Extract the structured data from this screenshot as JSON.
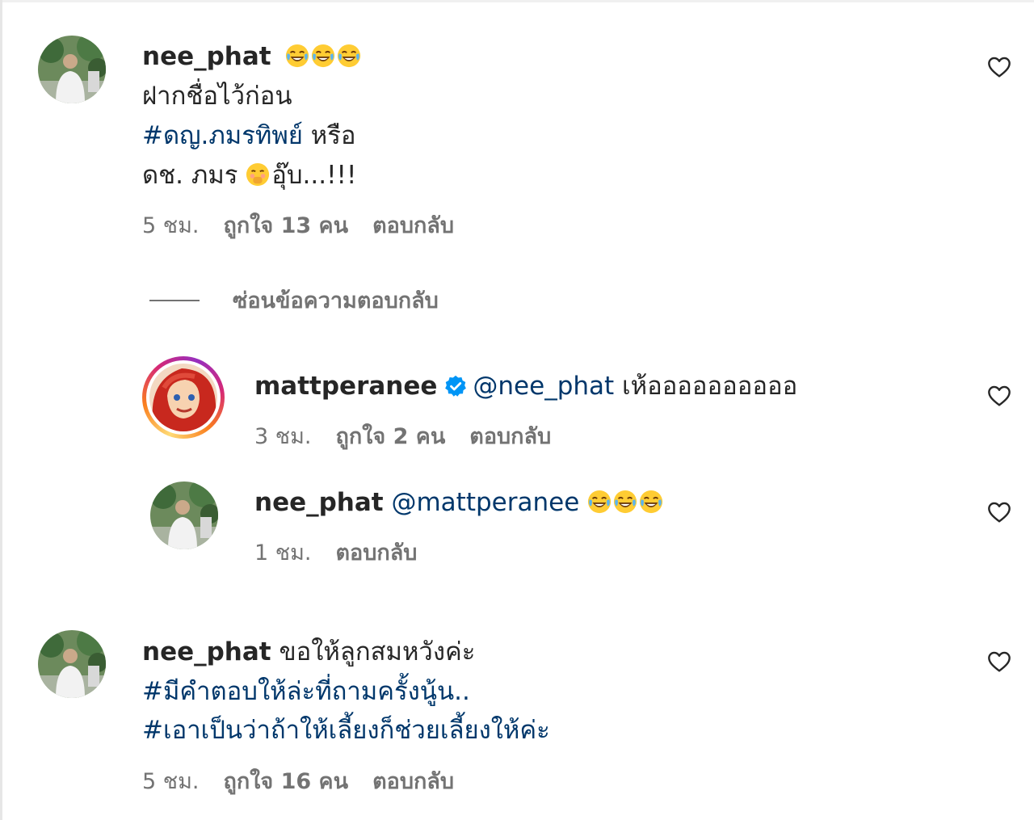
{
  "comments": [
    {
      "username": "nee_phat",
      "title_emoji": [
        "laughing-tears",
        "laughing-tears",
        "laughing-tears"
      ],
      "line1": "ฝากชื่อไว้ก่อน",
      "hashtag": "#ดญ.ภมรทิพย์",
      "line2_suffix": " หรือ",
      "line3_prefix": "ดช. ภมร ",
      "line3_suffix": "อุ๊บ...!!!",
      "time": "5 ชม.",
      "likes": "ถูกใจ 13 คน",
      "reply": "ตอบกลับ"
    },
    {
      "username": "nee_phat",
      "text": " ขอให้ลูกสมหวังค่ะ",
      "hashtag1": "#มีคำตอบให้ล่ะที่ถามครั้งนู้น..",
      "hashtag2": "#เอาเป็นว่าถ้าให้เลี้ยงก็ช่วยเลี้ยงให้ค่ะ",
      "time": "5 ชม.",
      "likes": "ถูกใจ 16 คน",
      "reply": "ตอบกลับ"
    }
  ],
  "hide_replies": "ซ่อนข้อความตอบกลับ",
  "replies": [
    {
      "username": "mattperanee",
      "mention": "@nee_phat",
      "text": " เห้ออออออออออ",
      "time": "3 ชม.",
      "likes": "ถูกใจ 2 คน",
      "reply": "ตอบกลับ"
    },
    {
      "username": "nee_phat",
      "mention": "@mattperanee",
      "time": "1 ชม.",
      "reply": "ตอบกลับ"
    }
  ],
  "colors": {
    "hashtag": "#00376b",
    "meta": "#737373",
    "verified": "#0095f6"
  }
}
